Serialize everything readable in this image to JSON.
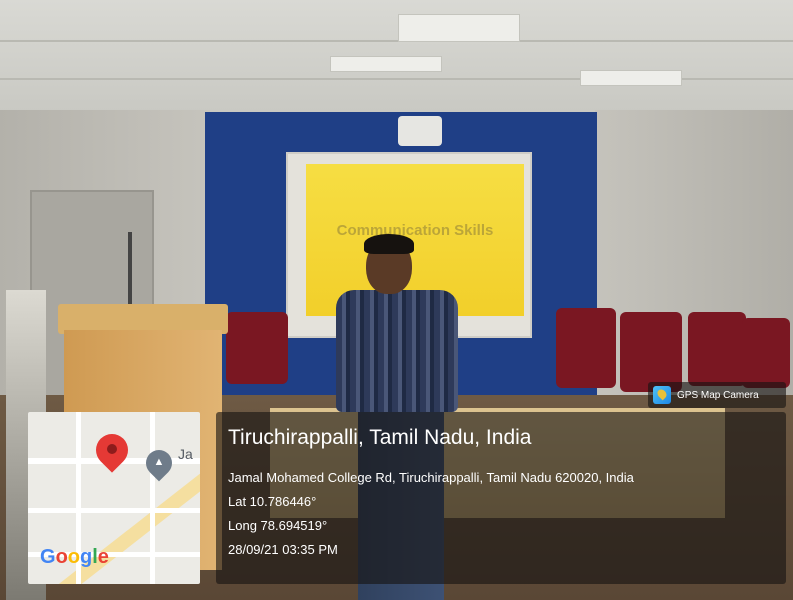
{
  "slide": {
    "text": "Communication Skills"
  },
  "app_badge": {
    "icon": "gps-map-camera-icon",
    "label": "GPS Map Camera"
  },
  "map": {
    "label": "Ja",
    "logo_letters": [
      "G",
      "o",
      "o",
      "g",
      "l",
      "e"
    ],
    "logo_colors": [
      "#4285f4",
      "#ea4335",
      "#fbbc05",
      "#4285f4",
      "#34a853",
      "#ea4335"
    ],
    "pin_color": "#e53935"
  },
  "location": {
    "title": "Tiruchirappalli, Tamil Nadu, India",
    "address": "Jamal Mohamed College Rd, Tiruchirappalli, Tamil Nadu 620020, India",
    "lat": "Lat 10.786446°",
    "long": "Long 78.694519°",
    "datetime": "28/09/21 03:35 PM"
  }
}
